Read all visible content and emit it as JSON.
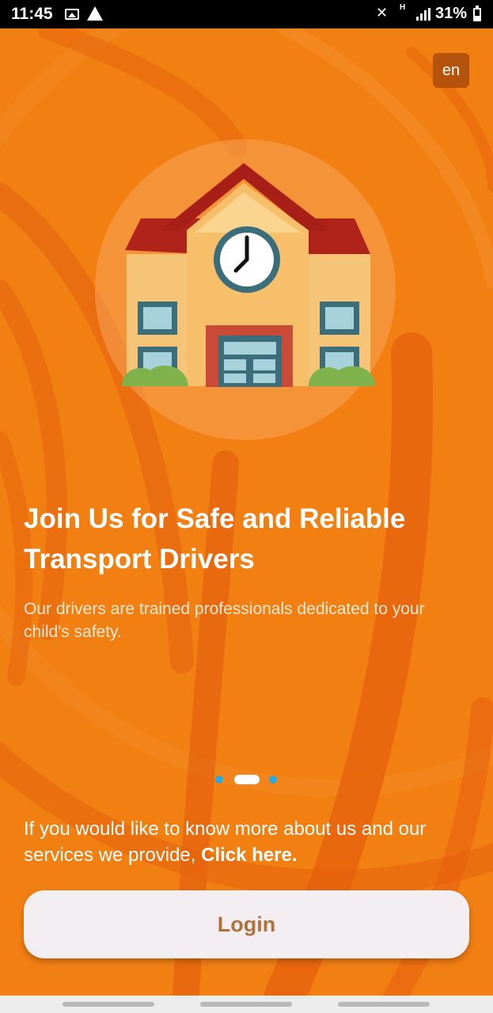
{
  "status_bar": {
    "time": "11:45",
    "network_type": "H",
    "battery_percent": "31%",
    "icons": [
      "gallery-icon",
      "warning-icon",
      "mute-icon",
      "signal-icon",
      "battery-icon"
    ]
  },
  "language_button": {
    "label": "en"
  },
  "illustration": {
    "icon": "school-building-icon"
  },
  "onboarding": {
    "title": "Join Us for Safe and Reliable Transport Drivers",
    "subtitle": "Our drivers are trained professionals dedicated to your child's safety.",
    "page_indicator": {
      "total": 3,
      "active_index": 1
    }
  },
  "info": {
    "text": "If you would like to know more about us and our services we provide, ",
    "link_label": "Click here."
  },
  "login_button": {
    "label": "Login"
  },
  "colors": {
    "background": "#f27f12",
    "accent_dot": "#2aa9e0",
    "button_text": "#b0723d",
    "button_bg": "#f2eef2"
  }
}
